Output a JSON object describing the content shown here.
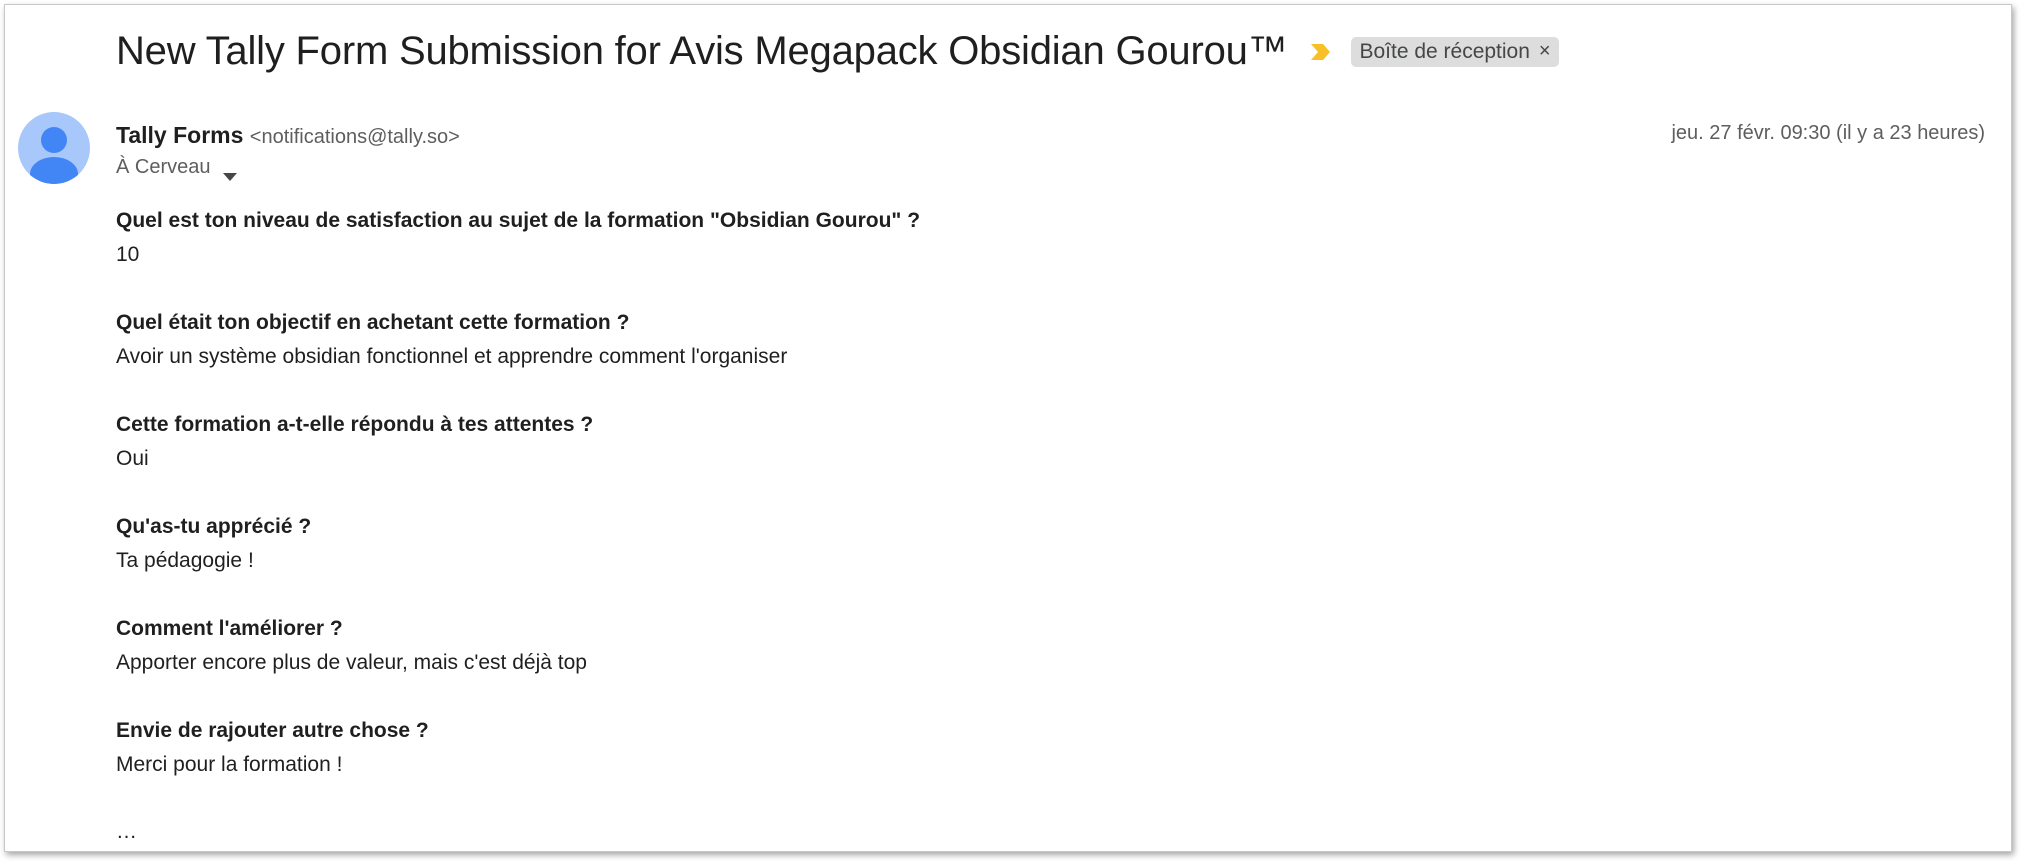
{
  "email": {
    "subject": "New Tally Form Submission for Avis Megapack Obsidian Gourou™",
    "label": "Boîte de réception",
    "label_remove": "×",
    "importance_icon": "importance-marker-icon",
    "sender_name": "Tally Forms",
    "sender_email": "<notifications@tally.so>",
    "date": "jeu. 27 févr. 09:30 (il y a 23 heures)",
    "recipient": "À Cerveau",
    "more_indicator": "…"
  },
  "body": {
    "items": [
      {
        "question": "Quel est ton niveau de satisfaction au sujet de la formation \"Obsidian Gourou\" ?",
        "answer": "10"
      },
      {
        "question": "Quel était ton objectif en achetant cette formation ?",
        "answer": "Avoir un système obsidian fonctionnel et apprendre comment l'organiser"
      },
      {
        "question": "Cette formation a-t-elle répondu à tes attentes ?",
        "answer": "Oui"
      },
      {
        "question": "Qu'as-tu apprécié ?",
        "answer": "Ta pédagogie !"
      },
      {
        "question": "Comment l'améliorer ?",
        "answer": "Apporter encore plus de valeur, mais c'est déjà top"
      },
      {
        "question": "Envie de rajouter autre chose ?",
        "answer": "Merci pour la formation !"
      }
    ]
  },
  "colors": {
    "importance": "#f6c026",
    "avatar_bg": "#a8c7fa",
    "avatar_fg": "#4285f4",
    "chip_bg": "#dddddd"
  }
}
